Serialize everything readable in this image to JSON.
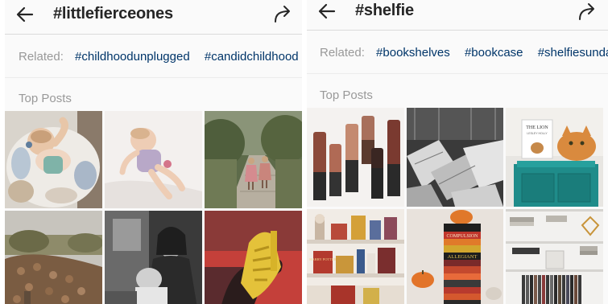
{
  "panels": [
    {
      "hashtag": "#littlefierceones",
      "related_label": "Related:",
      "related_tags": [
        "#childhoodunplugged",
        "#candidchildhood"
      ],
      "section_label": "Top Posts"
    },
    {
      "hashtag": "#shelfie",
      "related_label": "Related:",
      "related_tags": [
        "#bookshelves",
        "#bookcase",
        "#shelfiesunday"
      ],
      "section_label": "Top Posts"
    }
  ],
  "icons": {
    "back": "back-arrow-icon",
    "share": "share-arrow-icon"
  },
  "colors": {
    "link": "#003569",
    "muted": "#999999",
    "text": "#262626",
    "divider": "#dbdbdb"
  },
  "photo_text": {
    "book_cover_title": "THE LION",
    "book_cover_author": "LESLEY HOLLY",
    "harry_potter": "HARRY POTTER",
    "allegiant": "ALLEGIANT",
    "compulsion": "COMPULSION"
  }
}
